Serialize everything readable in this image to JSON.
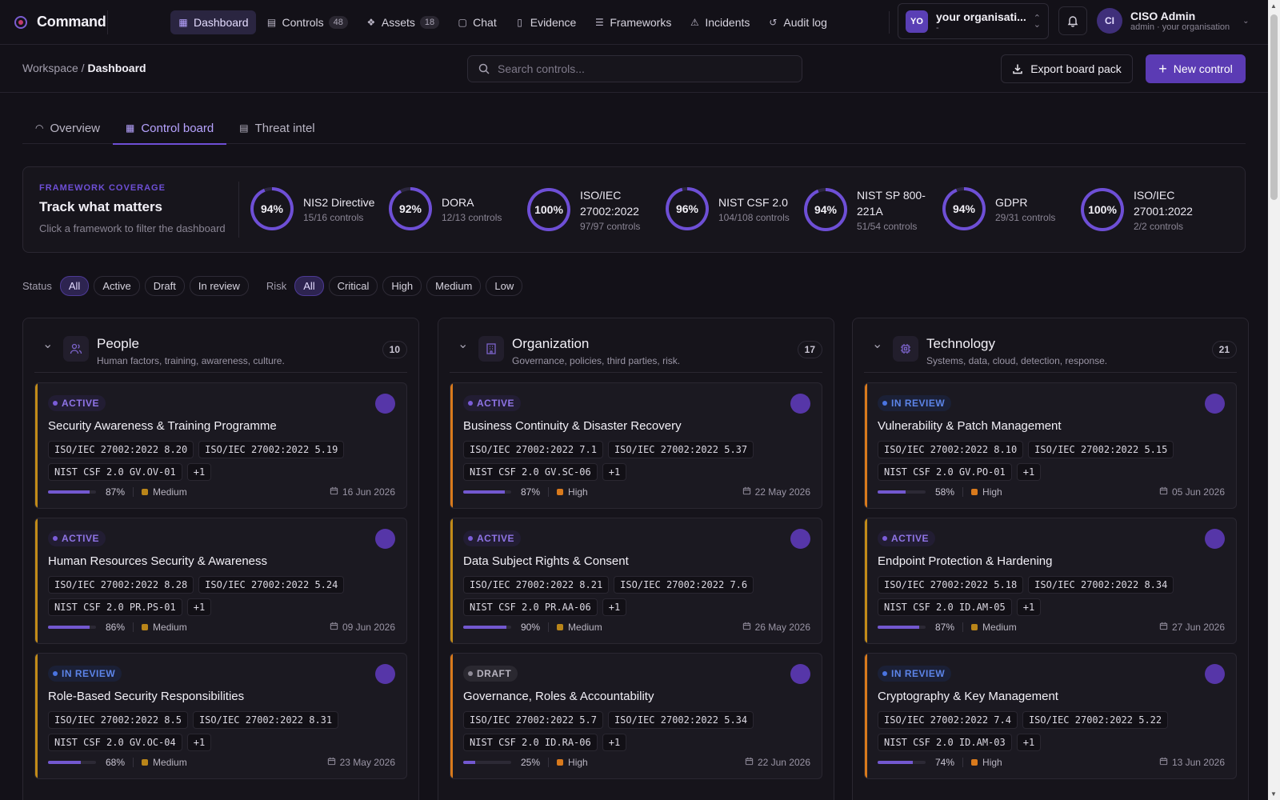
{
  "app": {
    "name": "Command"
  },
  "nav": [
    {
      "id": "dashboard",
      "label": "Dashboard",
      "icon": "grid-icon",
      "glyph": "▦",
      "active": true
    },
    {
      "id": "controls",
      "label": "Controls",
      "count": "48",
      "icon": "document-icon",
      "glyph": "▤"
    },
    {
      "id": "assets",
      "label": "Assets",
      "count": "18",
      "icon": "cubes-icon",
      "glyph": "❖"
    },
    {
      "id": "chat",
      "label": "Chat",
      "icon": "chat-icon",
      "glyph": "▢"
    },
    {
      "id": "evidence",
      "label": "Evidence",
      "icon": "book-icon",
      "glyph": "▯"
    },
    {
      "id": "frameworks",
      "label": "Frameworks",
      "icon": "checklist-icon",
      "glyph": "☰"
    },
    {
      "id": "incidents",
      "label": "Incidents",
      "icon": "siren-icon",
      "glyph": "⚠"
    },
    {
      "id": "audit",
      "label": "Audit log",
      "icon": "history-icon",
      "glyph": "↺"
    }
  ],
  "org": {
    "initials": "YO",
    "name": "your organisati...",
    "sub": "-"
  },
  "user": {
    "initials": "CI",
    "name": "CISO Admin",
    "sub": "admin · your organisation"
  },
  "breadcrumb": {
    "root": "Workspace",
    "sep": "/",
    "current": "Dashboard"
  },
  "search": {
    "placeholder": "Search controls..."
  },
  "actions": {
    "export": "Export board pack",
    "new_control": "New control"
  },
  "tabs": [
    {
      "label": "Overview",
      "icon": "gauge-icon"
    },
    {
      "label": "Control board",
      "icon": "grid-icon",
      "active": true
    },
    {
      "label": "Threat intel",
      "icon": "newspaper-icon"
    }
  ],
  "coverage": {
    "eyebrow": "FRAMEWORK COVERAGE",
    "title": "Track what matters",
    "subtitle": "Click a framework to filter the dashboard",
    "frameworks": [
      {
        "pct": 94,
        "label": "94%",
        "name": "NIS2 Directive",
        "controls": "15/16 controls"
      },
      {
        "pct": 92,
        "label": "92%",
        "name": "DORA",
        "controls": "12/13 controls"
      },
      {
        "pct": 100,
        "label": "100%",
        "name": "ISO/IEC 27002:2022",
        "controls": "97/97 controls"
      },
      {
        "pct": 96,
        "label": "96%",
        "name": "NIST CSF 2.0",
        "controls": "104/108 controls"
      },
      {
        "pct": 94,
        "label": "94%",
        "name": "NIST SP 800-221A",
        "controls": "51/54 controls"
      },
      {
        "pct": 94,
        "label": "94%",
        "name": "GDPR",
        "controls": "29/31 controls"
      },
      {
        "pct": 100,
        "label": "100%",
        "name": "ISO/IEC 27001:2022",
        "controls": "2/2 controls"
      }
    ]
  },
  "filters": {
    "status_label": "Status",
    "status": [
      {
        "label": "All",
        "active": true
      },
      {
        "label": "Active"
      },
      {
        "label": "Draft"
      },
      {
        "label": "In review"
      }
    ],
    "risk_label": "Risk",
    "risk": [
      {
        "label": "All",
        "active": true
      },
      {
        "label": "Critical"
      },
      {
        "label": "High"
      },
      {
        "label": "Medium"
      },
      {
        "label": "Low"
      }
    ]
  },
  "columns": [
    {
      "title": "People",
      "subtitle": "Human factors, training, awareness, culture.",
      "count": "10",
      "icon": "users-icon",
      "cards": [
        {
          "status": "ACTIVE",
          "title": "Security Awareness & Training Programme",
          "tags": [
            "ISO/IEC 27002:2022 8.20",
            "ISO/IEC 27002:2022 5.19",
            "NIST CSF 2.0 GV.OV-01",
            "+1"
          ],
          "progress": 87,
          "progress_label": "87%",
          "risk": "Medium",
          "date": "16 Jun 2026"
        },
        {
          "status": "ACTIVE",
          "title": "Human Resources Security & Awareness",
          "tags": [
            "ISO/IEC 27002:2022 8.28",
            "ISO/IEC 27002:2022 5.24",
            "NIST CSF 2.0 PR.PS-01",
            "+1"
          ],
          "progress": 86,
          "progress_label": "86%",
          "risk": "Medium",
          "date": "09 Jun 2026"
        },
        {
          "status": "IN REVIEW",
          "title": "Role-Based Security Responsibilities",
          "tags": [
            "ISO/IEC 27002:2022 8.5",
            "ISO/IEC 27002:2022 8.31",
            "NIST CSF 2.0 GV.OC-04",
            "+1"
          ],
          "progress": 68,
          "progress_label": "68%",
          "risk": "Medium",
          "date": "23 May 2026"
        }
      ]
    },
    {
      "title": "Organization",
      "subtitle": "Governance, policies, third parties, risk.",
      "count": "17",
      "icon": "building-icon",
      "cards": [
        {
          "status": "ACTIVE",
          "title": "Business Continuity & Disaster Recovery",
          "tags": [
            "ISO/IEC 27002:2022 7.1",
            "ISO/IEC 27002:2022 5.37",
            "NIST CSF 2.0 GV.SC-06",
            "+1"
          ],
          "progress": 87,
          "progress_label": "87%",
          "risk": "High",
          "date": "22 May 2026"
        },
        {
          "status": "ACTIVE",
          "title": "Data Subject Rights & Consent",
          "tags": [
            "ISO/IEC 27002:2022 8.21",
            "ISO/IEC 27002:2022 7.6",
            "NIST CSF 2.0 PR.AA-06",
            "+1"
          ],
          "progress": 90,
          "progress_label": "90%",
          "risk": "Medium",
          "date": "26 May 2026"
        },
        {
          "status": "DRAFT",
          "title": "Governance, Roles & Accountability",
          "tags": [
            "ISO/IEC 27002:2022 5.7",
            "ISO/IEC 27002:2022 5.34",
            "NIST CSF 2.0 ID.RA-06",
            "+1"
          ],
          "progress": 25,
          "progress_label": "25%",
          "risk": "High",
          "date": "22 Jun 2026"
        }
      ]
    },
    {
      "title": "Technology",
      "subtitle": "Systems, data, cloud, detection, response.",
      "count": "21",
      "icon": "chip-icon",
      "cards": [
        {
          "status": "IN REVIEW",
          "title": "Vulnerability & Patch Management",
          "tags": [
            "ISO/IEC 27002:2022 8.10",
            "ISO/IEC 27002:2022 5.15",
            "NIST CSF 2.0 GV.PO-01",
            "+1"
          ],
          "progress": 58,
          "progress_label": "58%",
          "risk": "High",
          "date": "05 Jun 2026"
        },
        {
          "status": "ACTIVE",
          "title": "Endpoint Protection & Hardening",
          "tags": [
            "ISO/IEC 27002:2022 5.18",
            "ISO/IEC 27002:2022 8.34",
            "NIST CSF 2.0 ID.AM-05",
            "+1"
          ],
          "progress": 87,
          "progress_label": "87%",
          "risk": "Medium",
          "date": "27 Jun 2026"
        },
        {
          "status": "IN REVIEW",
          "title": "Cryptography & Key Management",
          "tags": [
            "ISO/IEC 27002:2022 7.4",
            "ISO/IEC 27002:2022 5.22",
            "NIST CSF 2.0 ID.AM-03",
            "+1"
          ],
          "progress": 74,
          "progress_label": "74%",
          "risk": "High",
          "date": "13 Jun 2026"
        }
      ]
    }
  ],
  "colors": {
    "accent": "#6e4fd6",
    "primary_button": "#5b3bb4",
    "medium": "#b98519",
    "high": "#d97a1c",
    "ring_track": "#2c2740"
  }
}
